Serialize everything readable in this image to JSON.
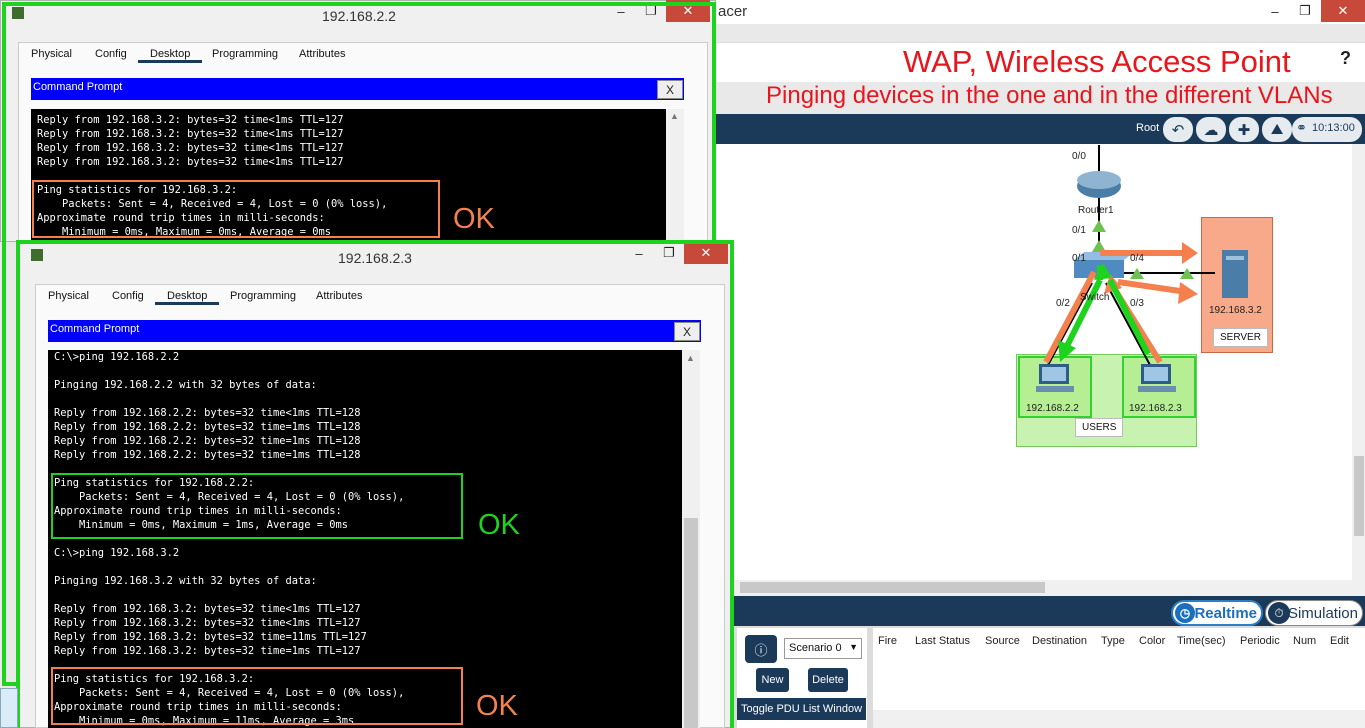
{
  "background_app": {
    "title_fragment": "acer",
    "help_icon": "?",
    "toolbar": {
      "root_label": "Root",
      "clock": "10:13:00",
      "icons": [
        "back-arrow-icon",
        "cloud-icon",
        "move-icon",
        "image-icon",
        "clock-network-icon"
      ]
    },
    "diagram": {
      "router": {
        "name": "Router1",
        "port_top": "0/0",
        "port_bottom": "0/1"
      },
      "switch": {
        "name": "Switch",
        "port_top": "0/1",
        "port_right": "0/4",
        "port_left": "0/2",
        "port_right_bottom": "0/3"
      },
      "server": {
        "ip": "192.168.3.2",
        "group": "SERVER"
      },
      "pc_a": {
        "ip": "192.168.2.2"
      },
      "pc_b": {
        "ip": "192.168.2.3"
      },
      "users_group": "USERS"
    },
    "mode": {
      "realtime": "Realtime",
      "simulation": "Simulation"
    },
    "pdu": {
      "scenario": "Scenario 0",
      "new": "New",
      "delete": "Delete",
      "toggle": "Toggle PDU List Window",
      "columns": [
        "Fire",
        "Last Status",
        "Source",
        "Destination",
        "Type",
        "Color",
        "Time(sec)",
        "Periodic",
        "Num",
        "Edit"
      ]
    }
  },
  "overlay": {
    "title": "WAP, Wireless Access Point",
    "subtitle": "Pinging devices in the one and in the different VLANs",
    "ok_label": "OK",
    "colors": {
      "red": "#e8161c",
      "orange": "#f4804e",
      "green": "#1ed31e"
    }
  },
  "window1": {
    "title": "192.168.2.2",
    "tabs": [
      "Physical",
      "Config",
      "Desktop",
      "Programming",
      "Attributes"
    ],
    "active_tab": "Desktop",
    "cmd_title": "Command Prompt",
    "close": "X",
    "lines": [
      "Reply from 192.168.3.2: bytes=32 time<1ms TTL=127",
      "Reply from 192.168.3.2: bytes=32 time<1ms TTL=127",
      "Reply from 192.168.3.2: bytes=32 time<1ms TTL=127",
      "Reply from 192.168.3.2: bytes=32 time<1ms TTL=127",
      "",
      "Ping statistics for 192.168.3.2:",
      "    Packets: Sent = 4, Received = 4, Lost = 0 (0% loss),",
      "Approximate round trip times in milli-seconds:",
      "    Minimum = 0ms, Maximum = 0ms, Average = 0ms"
    ]
  },
  "window2": {
    "title": "192.168.2.3",
    "tabs": [
      "Physical",
      "Config",
      "Desktop",
      "Programming",
      "Attributes"
    ],
    "active_tab": "Desktop",
    "cmd_title": "Command Prompt",
    "close": "X",
    "lines": [
      "C:\\>ping 192.168.2.2",
      "",
      "Pinging 192.168.2.2 with 32 bytes of data:",
      "",
      "Reply from 192.168.2.2: bytes=32 time<1ms TTL=128",
      "Reply from 192.168.2.2: bytes=32 time=1ms TTL=128",
      "Reply from 192.168.2.2: bytes=32 time=1ms TTL=128",
      "Reply from 192.168.2.2: bytes=32 time=1ms TTL=128",
      "",
      "Ping statistics for 192.168.2.2:",
      "    Packets: Sent = 4, Received = 4, Lost = 0 (0% loss),",
      "Approximate round trip times in milli-seconds:",
      "    Minimum = 0ms, Maximum = 1ms, Average = 0ms",
      "",
      "C:\\>ping 192.168.3.2",
      "",
      "Pinging 192.168.3.2 with 32 bytes of data:",
      "",
      "Reply from 192.168.3.2: bytes=32 time<1ms TTL=127",
      "Reply from 192.168.3.2: bytes=32 time<1ms TTL=127",
      "Reply from 192.168.3.2: bytes=32 time=11ms TTL=127",
      "Reply from 192.168.3.2: bytes=32 time=1ms TTL=127",
      "",
      "Ping statistics for 192.168.3.2:",
      "    Packets: Sent = 4, Received = 4, Lost = 0 (0% loss),",
      "Approximate round trip times in milli-seconds:",
      "    Minimum = 0ms, Maximum = 11ms, Average = 3ms"
    ]
  }
}
